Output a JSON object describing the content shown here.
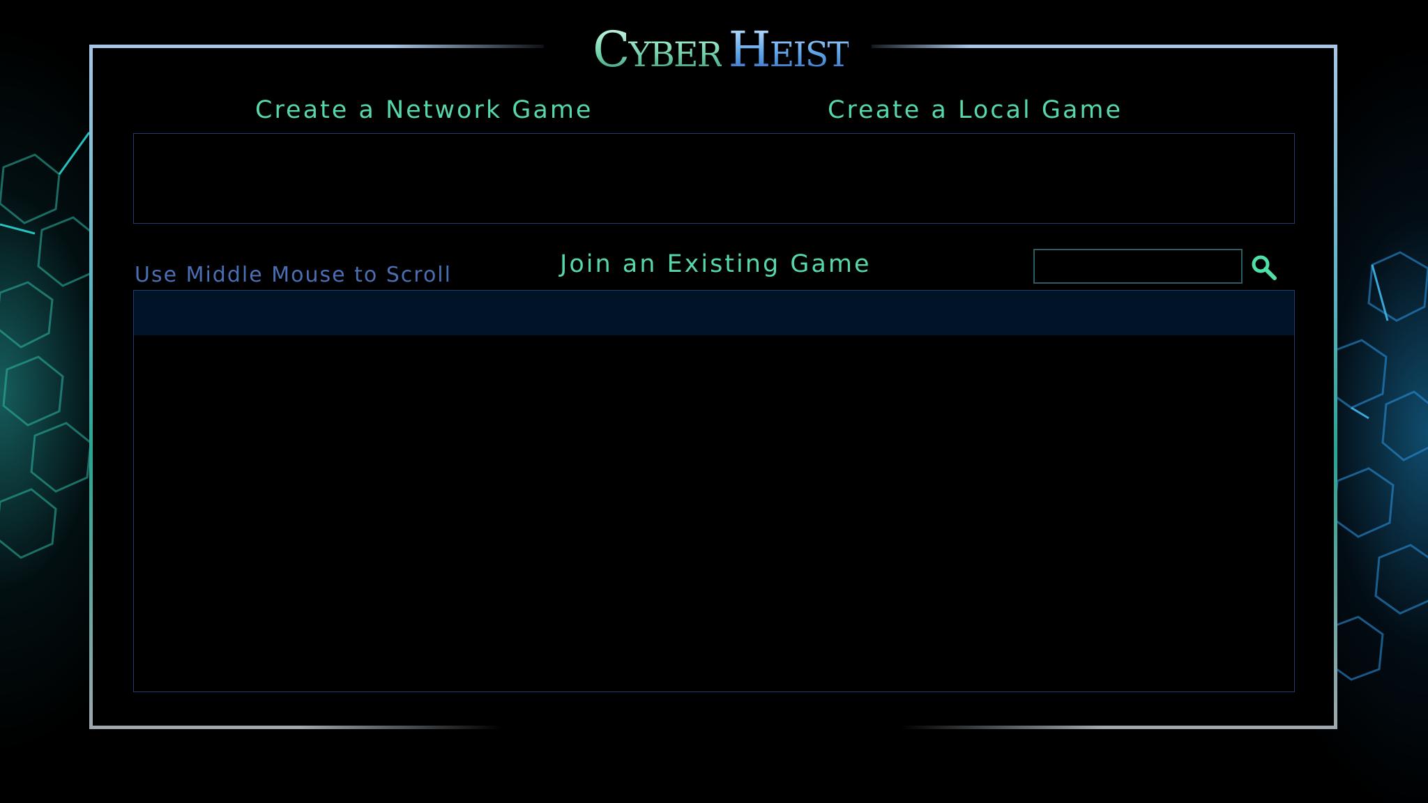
{
  "logo": {
    "word1": "Cyber",
    "word2": "Heist"
  },
  "menu": {
    "create_network": "Create a Network Game",
    "create_local": "Create a Local Game",
    "join_existing": "Join an Existing Game"
  },
  "hint": "Use Middle Mouse to Scroll",
  "search": {
    "value": "",
    "icon": "search-icon"
  },
  "game_list": {
    "rows": []
  },
  "colors": {
    "accent_green": "#56d8a8",
    "hint_blue": "#4a6fb5",
    "panel_border": "#1f3f6e",
    "list_header": "#011326"
  }
}
